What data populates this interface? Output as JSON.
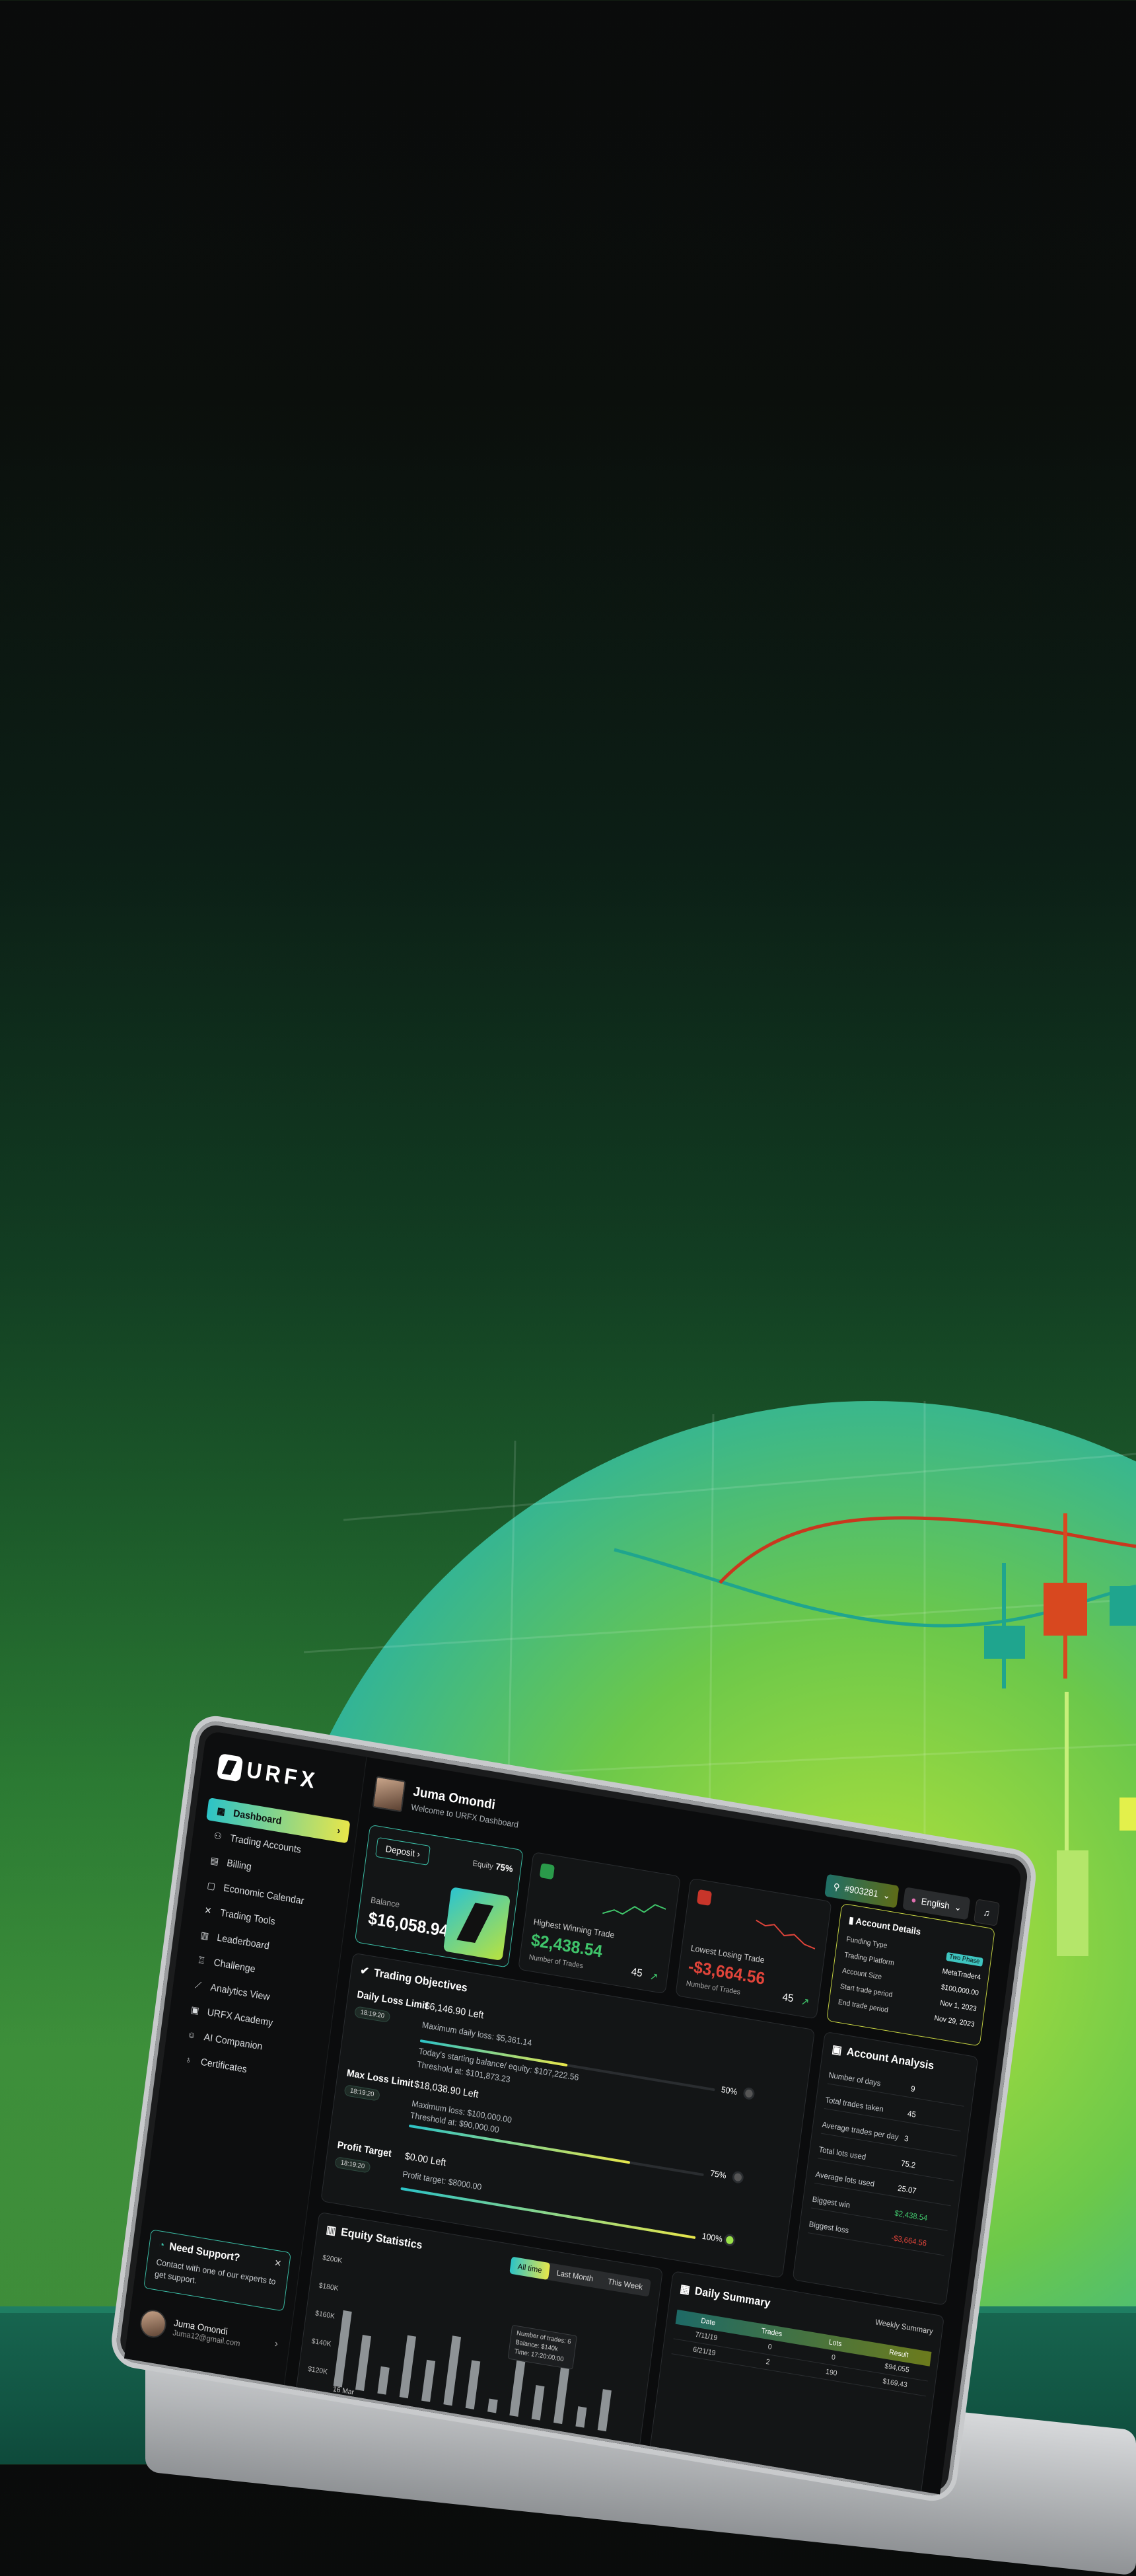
{
  "brand": {
    "name": "URFX"
  },
  "sidebar": {
    "items": [
      {
        "label": "Dashboard",
        "icon": "dashboard-icon",
        "active": true
      },
      {
        "label": "Trading Accounts",
        "icon": "users-icon"
      },
      {
        "label": "Billing",
        "icon": "billing-icon"
      },
      {
        "label": "Economic Calendar",
        "icon": "calendar-icon"
      },
      {
        "label": "Trading Tools",
        "icon": "tools-icon"
      },
      {
        "label": "Leaderboard",
        "icon": "leaderboard-icon"
      },
      {
        "label": "Challenge",
        "icon": "trophy-icon"
      },
      {
        "label": "Analytics View",
        "icon": "analytics-icon"
      },
      {
        "label": "URFX Academy",
        "icon": "academy-icon"
      },
      {
        "label": "AI Companion",
        "icon": "robot-icon"
      },
      {
        "label": "Certificates",
        "icon": "certificate-icon"
      }
    ],
    "support": {
      "title": "Need Support?",
      "text": "Contact with one of our experts to get support."
    },
    "user": {
      "name": "Juma Omondi",
      "email": "Juma12@gmail.com"
    }
  },
  "header": {
    "name": "Juma Omondi",
    "welcome": "Welcome to URFX Dashboard"
  },
  "topbar": {
    "account": "#903281",
    "language": "English"
  },
  "balance_card": {
    "deposit": "Deposit",
    "equity_label": "Equity",
    "equity_value": "75%",
    "balance_label": "Balance",
    "balance_value": "$16,058.94"
  },
  "win_card": {
    "label": "Highest Winning Trade",
    "value": "$2,438.54",
    "trades_label": "Number of Trades",
    "trades": "45"
  },
  "loss_card": {
    "label": "Lowest Losing Trade",
    "value": "-$3,664.56",
    "trades_label": "Number of Trades",
    "trades": "45"
  },
  "account_details": {
    "title": "Account Details",
    "rows": [
      {
        "k": "Funding Type",
        "v": "Two Phase"
      },
      {
        "k": "Trading Platform",
        "v": "MetaTrader4"
      },
      {
        "k": "Account Size",
        "v": "$100,000.00"
      },
      {
        "k": "Start trade period",
        "v": "Nov 1, 2023"
      },
      {
        "k": "End trade period",
        "v": "Nov 29, 2023"
      }
    ]
  },
  "objectives": {
    "title": "Trading Objectives",
    "items": [
      {
        "name": "Daily Loss Limit",
        "date": "18:19:20",
        "left": "$6,146.90 Left",
        "pct": "50%",
        "progress": 0.5,
        "lines": [
          "Maximum daily loss: $5,361.14",
          "Today's starting balance/ equity: $107,222.56",
          "Threshold at: $101,873.23"
        ]
      },
      {
        "name": "Max Loss Limit",
        "date": "18:19:20",
        "left": "$18,038.90 Left",
        "pct": "75%",
        "progress": 0.75,
        "lines": [
          "Maximum loss: $100,000.00",
          "Threshold at: $90,000.00"
        ]
      },
      {
        "name": "Profit Target",
        "date": "18:19:20",
        "left": "$0.00 Left",
        "pct": "100%",
        "progress": 1.0,
        "lines": [
          "Profit target: $8000.00"
        ]
      }
    ]
  },
  "analysis": {
    "title": "Account Analysis",
    "rows": [
      {
        "k": "Number of days",
        "v": "9"
      },
      {
        "k": "Total trades taken",
        "v": "45"
      },
      {
        "k": "Average trades per day",
        "v": "3"
      },
      {
        "k": "Total lots used",
        "v": "75.2"
      },
      {
        "k": "Average lots used",
        "v": "25.07"
      },
      {
        "k": "Biggest win",
        "v": "$2,438.54"
      },
      {
        "k": "Biggest loss",
        "v": "-$3,664.56"
      }
    ]
  },
  "equity": {
    "title": "Equity Statistics",
    "tabs": [
      "All time",
      "Last Month",
      "This Week"
    ],
    "tooltip": [
      "Number of trades: 6",
      "Balance: $140k",
      "Time: 17:20:00:00"
    ],
    "date_label": "16 Mar"
  },
  "chart_data": {
    "type": "bar",
    "title": "Equity Statistics",
    "ylabels": [
      "$200K",
      "$180K",
      "$160K",
      "$140K",
      "$120K"
    ],
    "values": [
      165,
      150,
      130,
      155,
      140,
      160,
      145,
      120,
      150,
      135,
      155,
      125,
      140
    ],
    "ylim": [
      120,
      200
    ]
  },
  "daily": {
    "title": "Daily Summary",
    "sub": "Weekly Summary",
    "headers": [
      "Date",
      "Trades",
      "Lots",
      "Result"
    ],
    "rows": [
      [
        "7/11/19",
        "0",
        "0",
        "$94,055"
      ],
      [
        "6/21/19",
        "2",
        "190",
        "$169.43"
      ]
    ]
  },
  "colors": {
    "accent_start": "#2cc3c7",
    "accent_end": "#e8e64a",
    "positive": "#3fc46a",
    "negative": "#e0443a"
  }
}
